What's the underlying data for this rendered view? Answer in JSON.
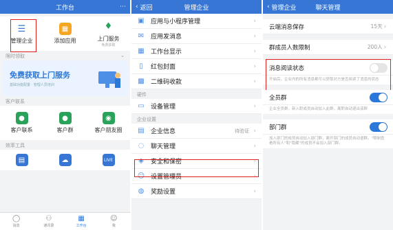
{
  "panel1": {
    "title": "工作台",
    "top_grid": [
      {
        "label": "管理企业",
        "sub": "",
        "icon": "sliders-icon",
        "color": "#3776d4"
      },
      {
        "label": "添加应用",
        "sub": "",
        "icon": "grid-plus-icon",
        "color": "#f5a623"
      },
      {
        "label": "上门服务",
        "sub": "免费获取",
        "icon": "tie-icon",
        "color": "#2aa35a"
      }
    ],
    "section_promo": "限时领取",
    "banner_title": "免费获取上门服务",
    "banner_sub": "基础功能配置 · 管理人员培训",
    "section_contacts": "客户联系",
    "contact_grid": [
      {
        "label": "客户联系",
        "color": "#2aa35a"
      },
      {
        "label": "客户群",
        "color": "#2aa35a"
      },
      {
        "label": "客户朋友圈",
        "color": "#2aa35a"
      }
    ],
    "section_tools": "效率工具",
    "tools_grid": [
      {
        "label": "",
        "color": "#3776d4"
      },
      {
        "label": "",
        "color": "#3776d4"
      },
      {
        "label": "LIVE",
        "color": "#3776d4"
      }
    ],
    "tabs": [
      {
        "label": "消息",
        "icon": "chat-icon"
      },
      {
        "label": "通讯录",
        "icon": "contacts-icon"
      },
      {
        "label": "工作台",
        "icon": "workbench-icon"
      },
      {
        "label": "我",
        "icon": "me-icon"
      }
    ]
  },
  "panel2": {
    "back": "返回",
    "title": "管理企业",
    "rows_a": [
      "应用与小程序管理",
      "应用发消息",
      "工作台显示",
      "红包封面",
      "二维码收款"
    ],
    "section_device": "硬件",
    "device_row": "设备管理",
    "section_ent": "企业设置",
    "ent_rows": [
      {
        "label": "企业信息",
        "tag": "待验证"
      },
      {
        "label": "聊天管理",
        "tag": ""
      },
      {
        "label": "安全和保密",
        "tag": ""
      },
      {
        "label": "设置管理员",
        "tag": ""
      },
      {
        "label": "奖励设置",
        "tag": ""
      }
    ]
  },
  "panel3": {
    "back": "管理企业",
    "title": "聊天管理",
    "cloud_label": "云端消息保存",
    "cloud_value": "15天",
    "limit_label": "群成员人数限制",
    "limit_value": "200人",
    "read_label": "消息阅读状态",
    "read_desc": "开启后，企业内的所有消息都可以获取对方是否阅读了消息的状态",
    "all_label": "全员群",
    "all_desc": "企业全员群，新入职成员自动加入此群，离职自动退出该群",
    "dept_label": "部门群",
    "dept_desc": "加入部门的成员自动加入部门群，离开部门的成员自动退群。\"限制查看所有人\"和\"隐藏\"的成员不会加入部门群。"
  }
}
